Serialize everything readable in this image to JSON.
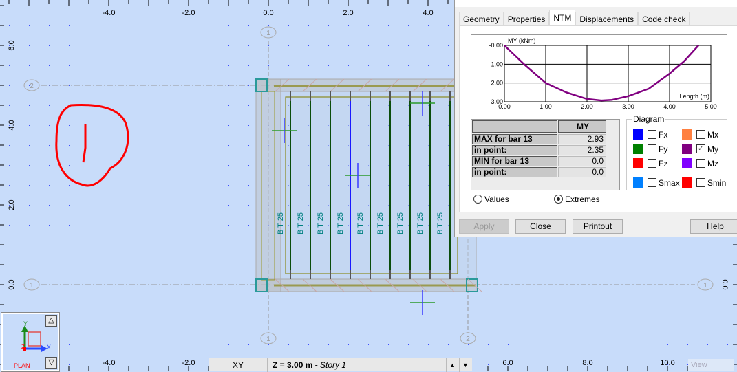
{
  "canvas": {
    "x_ticks": [
      "-4.0",
      "-2.0",
      "0.0",
      "2.0",
      "4.0",
      "6.0",
      "8.0",
      "10.0"
    ],
    "x_tick_values": [
      -4,
      -2,
      0,
      2,
      4,
      6,
      8,
      10
    ],
    "y_ticks": [
      "6.0",
      "4.0",
      "2.0",
      "0.0"
    ],
    "y_tick_values": [
      6,
      4,
      2,
      0
    ],
    "axis_labels": [
      "1",
      "2"
    ],
    "row_labels": [
      "2",
      "1"
    ],
    "bar_labels": [
      "B T 25",
      "B T 25",
      "B T 25",
      "B T 25",
      "B T 25",
      "B T 25",
      "B T 25",
      "B T 25",
      "B T 25"
    ],
    "selected_bar_index": 3,
    "colors": {
      "background": "#c8dcfa",
      "bar": "#0b4d0b",
      "selected_bar": "#1a1aff",
      "label": "#008080",
      "annotation": "#ff0000"
    }
  },
  "nav": {
    "plan_label": "PLAN",
    "axis_y": "Y",
    "axis_x": "X",
    "axis_z": "Z",
    "up": "△",
    "down": "▽"
  },
  "status": {
    "view": "XY",
    "level": "Z = 3.00 m - ",
    "story": "Story 1",
    "up": "▲",
    "down": "▼",
    "view_label": "View"
  },
  "dialog": {
    "tabs": [
      "Geometry",
      "Properties",
      "NTM",
      "Displacements",
      "Code check"
    ],
    "active_tab": 2,
    "chart_data": {
      "type": "line",
      "ylabel": "MY (kNm)",
      "xlabel": "Length (m)",
      "x_ticks": [
        "0.00",
        "1.00",
        "2.00",
        "3.00",
        "4.00",
        "5.00"
      ],
      "y_ticks": [
        "-0.00",
        "1.00",
        "2.00",
        "3.00"
      ],
      "xlim": [
        0,
        5
      ],
      "ylim": [
        0,
        3
      ],
      "y_inverted": true,
      "grid": true,
      "series": [
        {
          "color": "#800080",
          "x": [
            0,
            0.5,
            1,
            1.5,
            2,
            2.35,
            2.6,
            3,
            3.5,
            4,
            4.35,
            4.7
          ],
          "y": [
            0,
            1.05,
            2.0,
            2.5,
            2.85,
            2.93,
            2.9,
            2.7,
            2.3,
            1.5,
            0.85,
            0
          ]
        }
      ]
    },
    "table": {
      "header": "MY",
      "rows": [
        {
          "label": "MAX for bar 13",
          "value": "2.93"
        },
        {
          "label": "in point:",
          "value": "2.35"
        },
        {
          "label": "MIN for bar 13",
          "value": "0.0"
        },
        {
          "label": "in point:",
          "value": "0.0"
        }
      ]
    },
    "diagram": {
      "title": "Diagram",
      "items": [
        {
          "label": "Fx",
          "color": "#0000ff",
          "checked": false
        },
        {
          "label": "Mx",
          "color": "#ff8040",
          "checked": false
        },
        {
          "label": "Fy",
          "color": "#008000",
          "checked": false
        },
        {
          "label": "My",
          "color": "#800080",
          "checked": true
        },
        {
          "label": "Fz",
          "color": "#ff0000",
          "checked": false
        },
        {
          "label": "Mz",
          "color": "#8000ff",
          "checked": false
        },
        {
          "label": "Smax",
          "color": "#0080ff",
          "checked": false
        },
        {
          "label": "Smin",
          "color": "#ff0000",
          "checked": false
        }
      ]
    },
    "mode": {
      "values": "Values",
      "extremes": "Extremes",
      "selected": "Extremes"
    },
    "buttons": {
      "apply": "Apply",
      "close": "Close",
      "printout": "Printout",
      "help": "Help"
    }
  }
}
